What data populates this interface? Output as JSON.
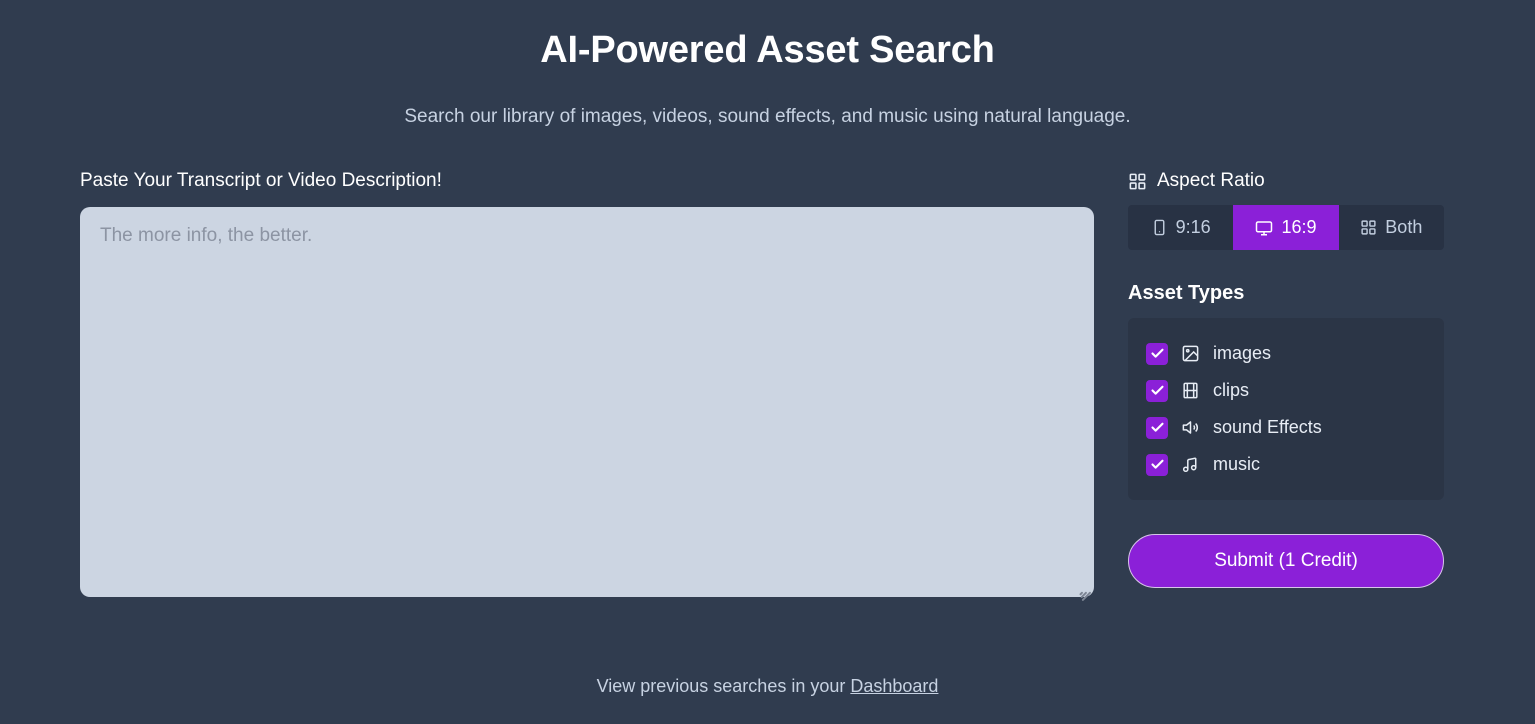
{
  "header": {
    "title": "AI-Powered Asset Search",
    "subtitle": "Search our library of images, videos, sound effects, and music using natural language."
  },
  "transcript": {
    "label": "Paste Your Transcript or Video Description!",
    "placeholder": "The more info, the better.",
    "value": ""
  },
  "aspect_ratio": {
    "heading": "Aspect Ratio",
    "heading_icon": "grid-icon",
    "selected": "16:9",
    "options": [
      {
        "label": "9:16",
        "icon": "smartphone-icon",
        "active": false
      },
      {
        "label": "16:9",
        "icon": "monitor-icon",
        "active": true
      },
      {
        "label": "Both",
        "icon": "grid-icon",
        "active": false
      }
    ]
  },
  "asset_types": {
    "heading": "Asset Types",
    "items": [
      {
        "label": "images",
        "icon": "image-icon",
        "checked": true
      },
      {
        "label": "clips",
        "icon": "film-icon",
        "checked": true
      },
      {
        "label": "sound Effects",
        "icon": "speaker-icon",
        "checked": true
      },
      {
        "label": "music",
        "icon": "music-note-icon",
        "checked": true
      }
    ]
  },
  "submit": {
    "label": "Submit (1 Credit)"
  },
  "footer": {
    "text": "View previous searches in your ",
    "link_label": "Dashboard"
  },
  "colors": {
    "background": "#303c4f",
    "accent": "#8b20d8",
    "panel": "#2b3546",
    "segmented_track": "#283244",
    "textarea": "#ccd5e2",
    "text_primary": "#ffffff",
    "text_secondary": "#c7d2e2"
  }
}
